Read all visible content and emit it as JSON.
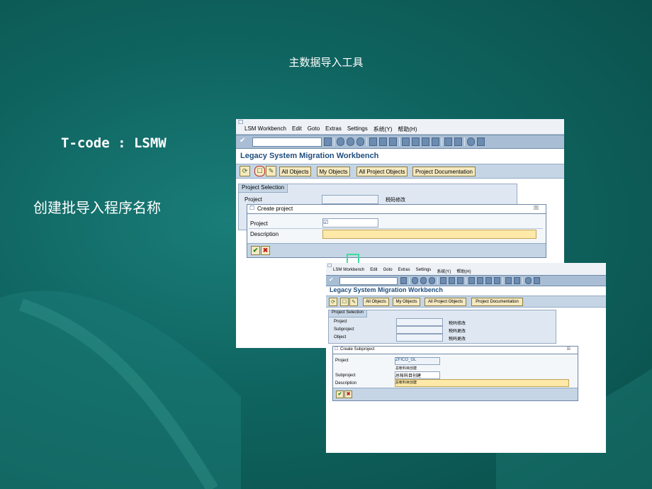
{
  "slide": {
    "title": "主数据导入工具",
    "tcode": "T-code  :  LSMW",
    "caption": "创建批导入程序名称"
  },
  "colors": {
    "background": "#0f6460",
    "sap_title": "#1f4e7f",
    "button": "#f5e9c0",
    "required_field": "#ffe9a8",
    "arrow": "#3ddc9c"
  },
  "menu": [
    "LSM Workbench",
    "Edit",
    "Goto",
    "Extras",
    "Settings",
    "系统(Y)",
    "帮助(H)"
  ],
  "window1": {
    "app_title": "Legacy System Migration Workbench",
    "buttons": [
      "All Objects",
      "My Objects",
      "All Project Objects",
      "Project Documentation"
    ],
    "frame_title": "Project Selection",
    "project_label": "Project",
    "project_hint": "税码修改",
    "dialog": {
      "title": "Create project",
      "project_label": "Project",
      "project_value": "☑",
      "description_label": "Description",
      "description_value": ""
    }
  },
  "window2": {
    "app_title": "Legacy System Migration Workbench",
    "buttons": [
      "All Objects",
      "My Objects",
      "All Project Objects",
      "Project Documentation"
    ],
    "frame_title": "Project Selection",
    "rows": [
      {
        "label": "Project",
        "hint": "税码修改"
      },
      {
        "label": "Subproject",
        "hint": "税码更改"
      },
      {
        "label": "Object",
        "hint": "税码更改"
      }
    ],
    "dialog": {
      "title": "Create Subproject",
      "project_label": "Project",
      "project_value": "ZFICO_GL",
      "project_note": "总帐科目创建",
      "subproject_label": "Subproject",
      "subproject_value": "总帐科目创建",
      "description_label": "Description",
      "description_value": "总帐科目创建"
    }
  }
}
